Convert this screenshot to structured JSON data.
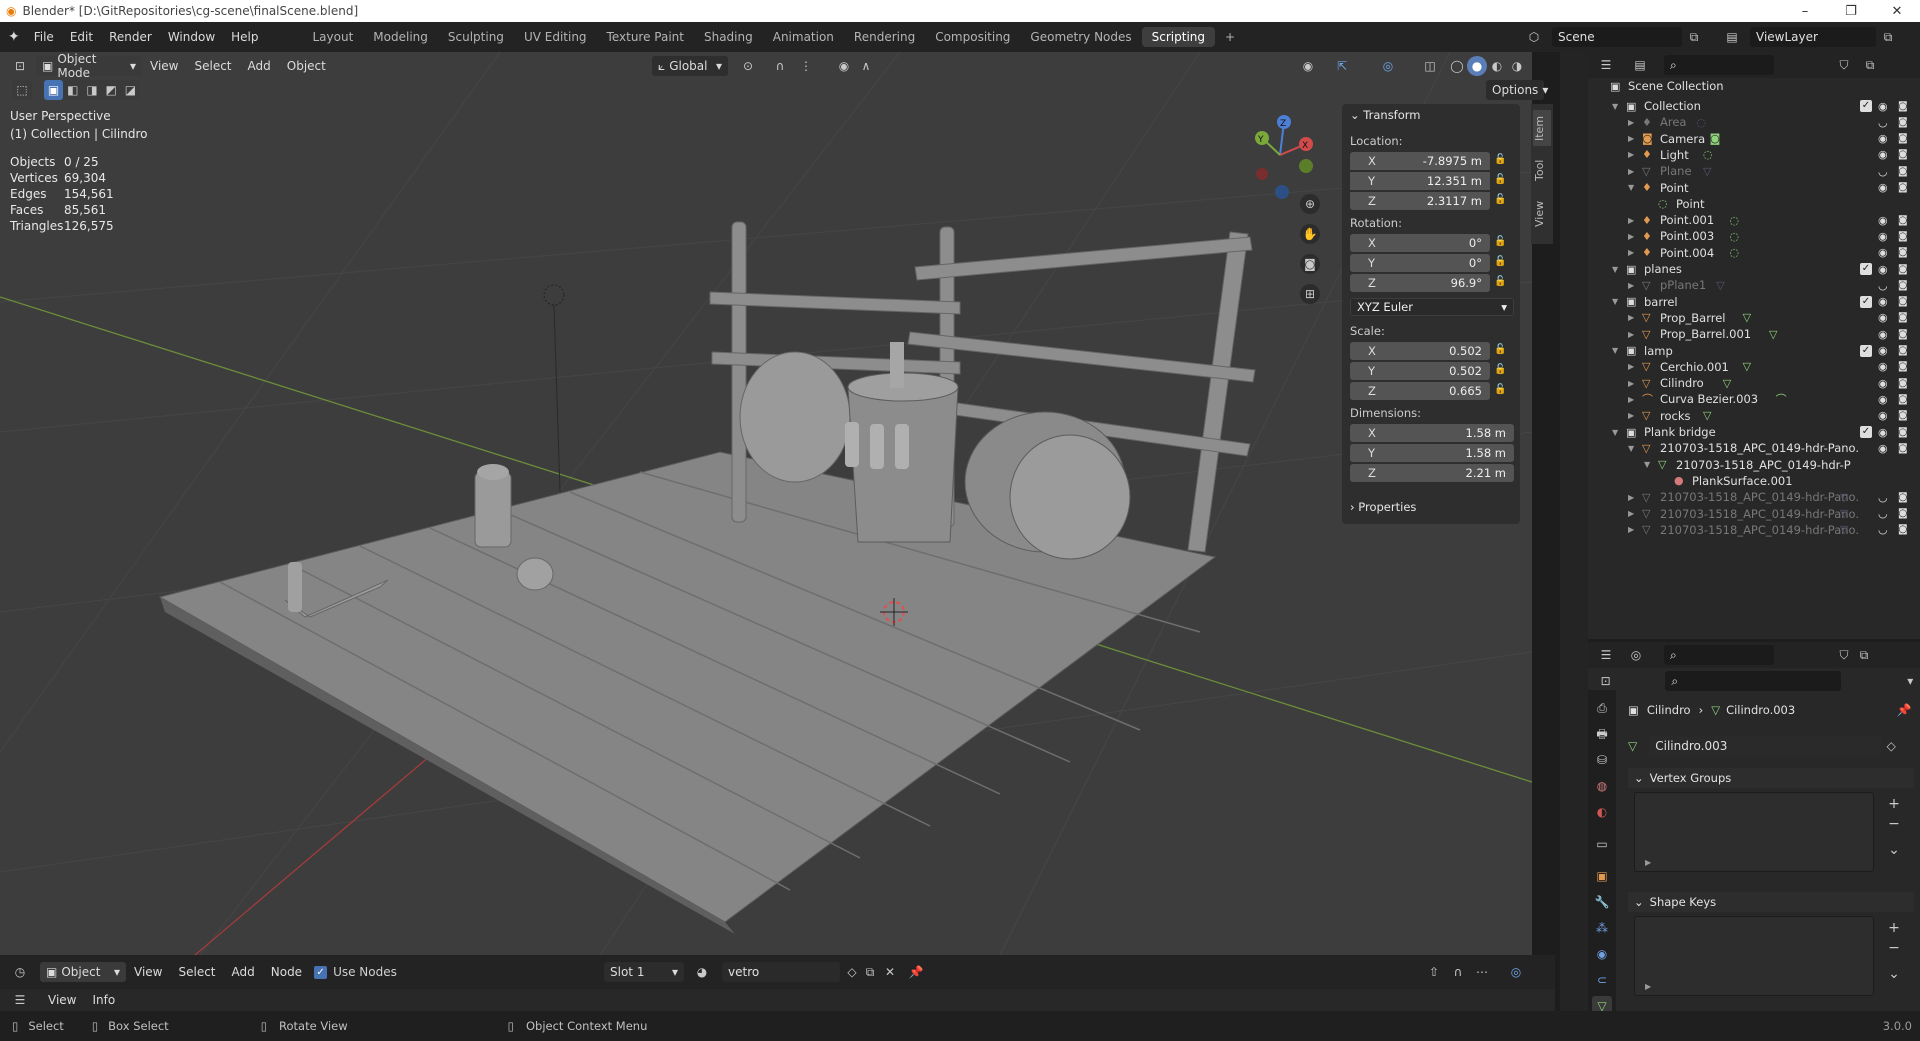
{
  "window": {
    "title": "Blender* [D:\\GitRepositories\\cg-scene\\finalScene.blend]",
    "minimize": "–",
    "maximize": "❐",
    "close": "✕"
  },
  "menu": [
    "File",
    "Edit",
    "Render",
    "Window",
    "Help"
  ],
  "workspaces": [
    "Layout",
    "Modeling",
    "Sculpting",
    "UV Editing",
    "Texture Paint",
    "Shading",
    "Animation",
    "Rendering",
    "Compositing",
    "Geometry Nodes",
    "Scripting"
  ],
  "active_workspace": "Scripting",
  "add_workspace": "+",
  "scene": {
    "name": "Scene",
    "view_layer": "ViewLayer"
  },
  "viewport": {
    "mode": "Object Mode",
    "menus": [
      "View",
      "Select",
      "Add",
      "Object"
    ],
    "orientation": "Global",
    "options": "Options",
    "perspective": "User Perspective",
    "context": "(1) Collection | Cilindro",
    "stats": [
      [
        "Objects",
        "0 / 25"
      ],
      [
        "Vertices",
        "69,304"
      ],
      [
        "Edges",
        "154,561"
      ],
      [
        "Faces",
        "85,561"
      ],
      [
        "Triangles",
        "126,575"
      ]
    ],
    "gizmo": {
      "x": "X",
      "y": "Y",
      "z": "Z"
    }
  },
  "npanel": {
    "tabs": [
      "Item",
      "Tool",
      "View"
    ],
    "transform": "Transform",
    "location_label": "Location:",
    "location": [
      [
        "X",
        "-7.8975 m"
      ],
      [
        "Y",
        "12.351 m"
      ],
      [
        "Z",
        "2.3117 m"
      ]
    ],
    "rotation_label": "Rotation:",
    "rotation": [
      [
        "X",
        "0°"
      ],
      [
        "Y",
        "0°"
      ],
      [
        "Z",
        "96.9°"
      ]
    ],
    "rotation_mode": "XYZ Euler",
    "scale_label": "Scale:",
    "scale": [
      [
        "X",
        "0.502"
      ],
      [
        "Y",
        "0.502"
      ],
      [
        "Z",
        "0.665"
      ]
    ],
    "dimensions_label": "Dimensions:",
    "dimensions": [
      [
        "X",
        "1.58 m"
      ],
      [
        "Y",
        "1.58 m"
      ],
      [
        "Z",
        "2.21 m"
      ]
    ],
    "properties": "Properties"
  },
  "outliner": {
    "root": "Scene Collection",
    "rows": [
      {
        "label": "Collection",
        "depth": 1,
        "kind": "coll",
        "open": true,
        "check": true
      },
      {
        "label": "Area",
        "depth": 2,
        "kind": "light",
        "dim": true
      },
      {
        "label": "Camera",
        "depth": 2,
        "kind": "cam"
      },
      {
        "label": "Light",
        "depth": 2,
        "kind": "light"
      },
      {
        "label": "Plane",
        "depth": 2,
        "kind": "mesh",
        "dim": true
      },
      {
        "label": "Point",
        "depth": 2,
        "kind": "light",
        "open": true
      },
      {
        "label": "Point",
        "depth": 3,
        "kind": "ldata"
      },
      {
        "label": "Point.001",
        "depth": 2,
        "kind": "light"
      },
      {
        "label": "Point.003",
        "depth": 2,
        "kind": "light"
      },
      {
        "label": "Point.004",
        "depth": 2,
        "kind": "light"
      },
      {
        "label": "planes",
        "depth": 1,
        "kind": "coll",
        "open": true,
        "check": true
      },
      {
        "label": "pPlane1",
        "depth": 2,
        "kind": "mesh",
        "dim": true
      },
      {
        "label": "barrel",
        "depth": 1,
        "kind": "coll",
        "open": true,
        "check": true
      },
      {
        "label": "Prop_Barrel",
        "depth": 2,
        "kind": "mesh"
      },
      {
        "label": "Prop_Barrel.001",
        "depth": 2,
        "kind": "mesh"
      },
      {
        "label": "lamp",
        "depth": 1,
        "kind": "coll",
        "open": true,
        "check": true
      },
      {
        "label": "Cerchio.001",
        "depth": 2,
        "kind": "mesh"
      },
      {
        "label": "Cilindro",
        "depth": 2,
        "kind": "mesh"
      },
      {
        "label": "Curva Bezier.003",
        "depth": 2,
        "kind": "curve"
      },
      {
        "label": "rocks",
        "depth": 2,
        "kind": "mesh"
      },
      {
        "label": "Plank bridge",
        "depth": 1,
        "kind": "coll",
        "open": true,
        "check": true
      },
      {
        "label": "210703-1518_APC_0149-hdr-Pano.",
        "depth": 2,
        "kind": "mesh",
        "open": true
      },
      {
        "label": "210703-1518_APC_0149-hdr-P",
        "depth": 3,
        "kind": "mdata",
        "open": true
      },
      {
        "label": "PlankSurface.001",
        "depth": 4,
        "kind": "mat"
      },
      {
        "label": "210703-1518_APC_0149-hdr-Pano.",
        "depth": 2,
        "kind": "mesh",
        "dim": true
      },
      {
        "label": "210703-1518_APC_0149-hdr-Pano.",
        "depth": 2,
        "kind": "mesh",
        "dim": true
      },
      {
        "label": "210703-1518_APC_0149-hdr-Pano.",
        "depth": 2,
        "kind": "mesh",
        "dim": true
      }
    ]
  },
  "properties": {
    "breadcrumb_object": "Cilindro",
    "breadcrumb_sep": "›",
    "breadcrumb_data": "Cilindro.003",
    "mesh_name": "Cilindro.003",
    "vertex_groups": "Vertex Groups",
    "shape_keys": "Shape Keys"
  },
  "shader_header": {
    "mode": "Object",
    "menus": [
      "View",
      "Select",
      "Add",
      "Node"
    ],
    "use_nodes": "Use Nodes",
    "slot": "Slot 1",
    "material": "vetro",
    "view": "View",
    "info": "Info"
  },
  "status": {
    "select": "Select",
    "box_select": "Box Select",
    "rotate": "Rotate View",
    "context_menu": "Object Context Menu",
    "version": "3.0.0"
  }
}
